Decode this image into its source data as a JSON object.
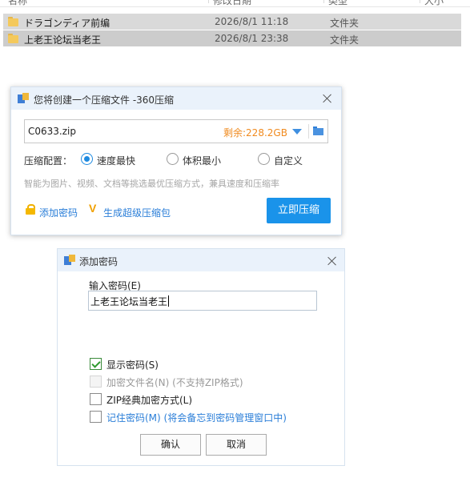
{
  "explorer": {
    "header": {
      "name": "名称",
      "date": "修改日期",
      "type": "类型",
      "size": "大小"
    },
    "rows": [
      {
        "name": "ドラゴンディア前编",
        "date": "2026/8/1 11:18",
        "type": "文件夹"
      },
      {
        "name": "上老王论坛当老王",
        "date": "2026/8/1 23:38",
        "type": "文件夹"
      }
    ]
  },
  "zip_dialog": {
    "title": "您将创建一个压缩文件 -360压缩",
    "filename": "C0633.zip",
    "free_space": "剩余:228.2GB",
    "config_label": "压缩配置：",
    "options": [
      "速度最快",
      "体积最小",
      "自定义"
    ],
    "selected_option": "速度最快",
    "hint": "智能为图片、视频、文档等挑选最优压缩方式，兼具速度和压缩率",
    "add_password": "添加密码",
    "super_compress": "生成超级压缩包",
    "compress_now": "立即压缩"
  },
  "password_dialog": {
    "title": "添加密码",
    "input_label": "输入密码(E)",
    "password_value": "上老王论坛当老王",
    "show_password": "显示密码(S)",
    "encrypt_filename": "加密文件名(N) (不支持ZIP格式)",
    "zip_classic": "ZIP经典加密方式(L)",
    "remember_password": "记住密码(M) (将会备忘到密码管理窗口中)",
    "ok": "确认",
    "cancel": "取消"
  },
  "colors": {
    "accent": "#1a93ea",
    "link": "#2a7ed8",
    "free_space": "#f08a1e",
    "title_bar": "#eaf2fb"
  }
}
